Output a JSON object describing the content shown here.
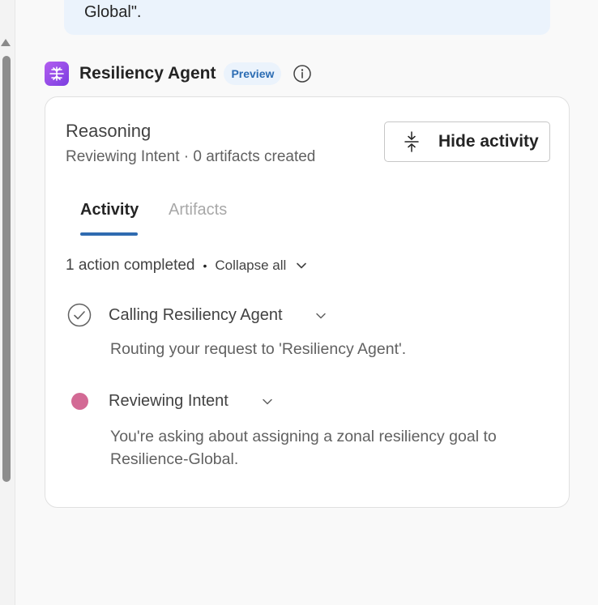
{
  "previous_message": {
    "tail_text": "Global\"."
  },
  "agent": {
    "name": "Resiliency Agent",
    "badge": "Preview",
    "logo_icon": "agent-logo-icon",
    "logo_color": "#9b4fea"
  },
  "card": {
    "title": "Reasoning",
    "subtitle": "Reviewing Intent · 0 artifacts created",
    "hide_button_label": "Hide activity",
    "tabs": [
      {
        "label": "Activity",
        "selected": true
      },
      {
        "label": "Artifacts",
        "selected": false
      }
    ],
    "summary": {
      "text": "1 action completed",
      "separator": "•",
      "collapse_label": "Collapse all"
    },
    "steps": [
      {
        "title": "Calling Resiliency Agent",
        "status": "completed",
        "description": "Routing your request to 'Resiliency Agent'."
      },
      {
        "title": "Reviewing Intent",
        "status": "in-progress",
        "description": "You're asking about assigning a zonal resiliency goal to Resilience-Global."
      }
    ]
  },
  "colors": {
    "accent": "#2f6bb0",
    "badge_bg": "#ebf3fc",
    "in_progress_dot": "#d36a95"
  }
}
